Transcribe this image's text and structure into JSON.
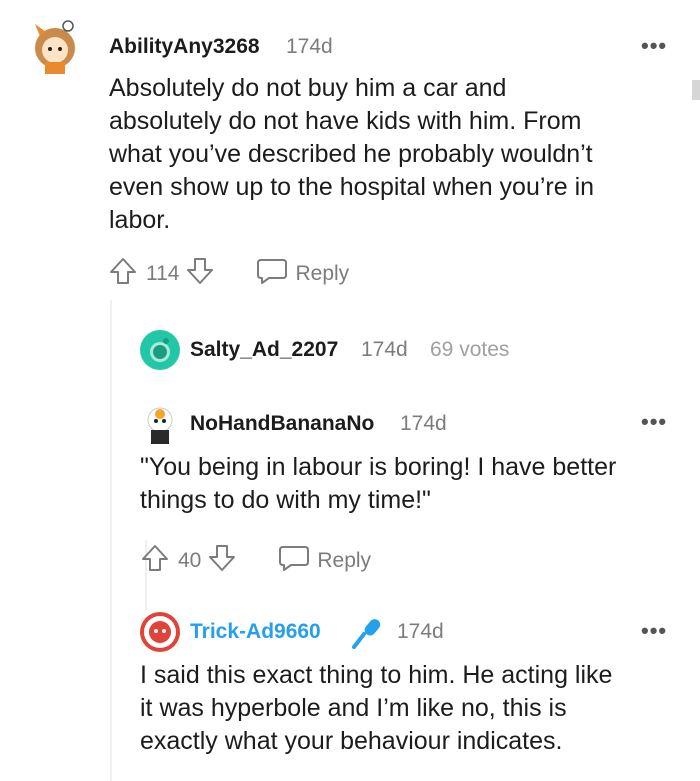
{
  "comments": [
    {
      "username": "AbilityAny3268",
      "age": "174d",
      "text_lines": [
        "Absolutely do not buy him a car and",
        "absolutely do not have kids with him. From",
        "what you’ve described he probably wouldn’t",
        "even show up to the hospital when you’re in",
        "labor."
      ],
      "score": "114",
      "reply_label": "Reply"
    },
    {
      "username": "Salty_Ad_2207",
      "age": "174d",
      "votes": "69 votes"
    },
    {
      "username": "NoHandBananaNo",
      "age": "174d",
      "text_lines": [
        "\"You being in labour is boring! I have better",
        "things to do with my time!\""
      ],
      "score": "40",
      "reply_label": "Reply"
    },
    {
      "username": "Trick-Ad9660",
      "age": "174d",
      "username_color": "#24a0ed",
      "text_lines": [
        "I said this exact thing to him. He acting like",
        "it was hyperbole and I’m like no, this is",
        "exactly what your behaviour indicates."
      ]
    }
  ],
  "more_glyph": "•••",
  "colors": {
    "meta": "#7c7c7c",
    "thread_line": "#edeff1",
    "mic_blue": "#24a0ed",
    "avatar_teal": "#24c7a5",
    "avatar_red": "#e0433a"
  },
  "icons": [
    "upvote-icon",
    "downvote-icon",
    "reply-bubble-icon",
    "microphone-icon",
    "more-options-icon"
  ]
}
